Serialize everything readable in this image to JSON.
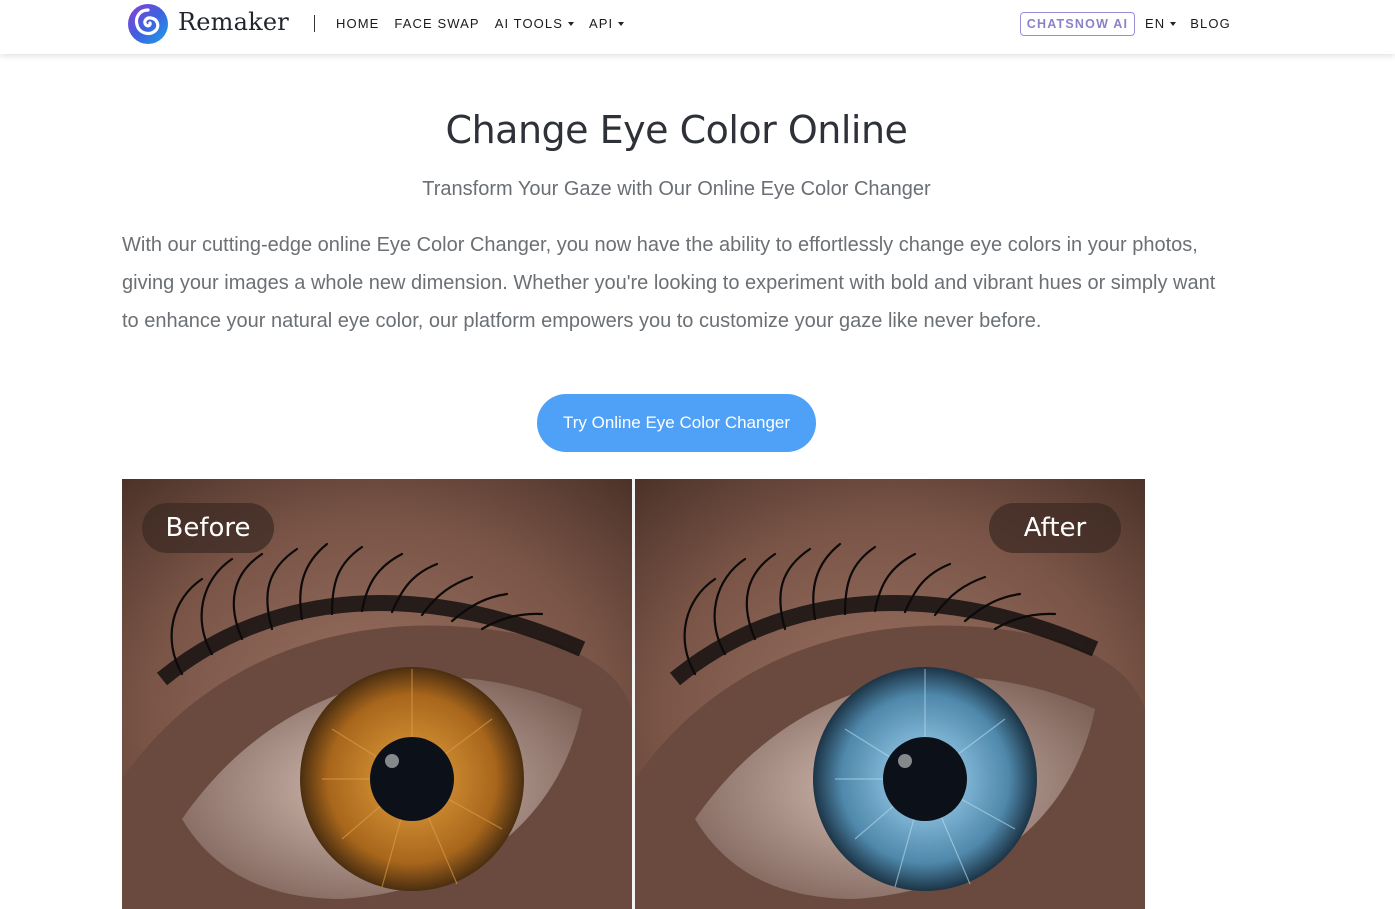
{
  "header": {
    "brand": "Remaker",
    "nav_left": [
      {
        "label": "HOME",
        "dropdown": false
      },
      {
        "label": "FACE SWAP",
        "dropdown": false
      },
      {
        "label": "AI TOOLS",
        "dropdown": true
      },
      {
        "label": "API",
        "dropdown": true
      }
    ],
    "chatsnow_label": "CHATSNOW AI",
    "language_label": "EN",
    "blog_label": "BLOG"
  },
  "main": {
    "title": "Change Eye Color Online",
    "subtitle": "Transform Your Gaze with Our Online Eye Color Changer",
    "description": "With our cutting-edge online Eye Color Changer, you now have the ability to effortlessly change eye colors in your photos, giving your images a whole new dimension. Whether you're looking to experiment with bold and vibrant hues or simply want to enhance your natural eye color, our platform empowers you to customize your gaze like never before.",
    "cta_label": "Try Online Eye Color Changer"
  },
  "comparison": {
    "before_label": "Before",
    "after_label": "After",
    "before_iris_color": "#b8772a",
    "after_iris_color": "#5b95b8"
  },
  "colors": {
    "accent": "#4fa0f7",
    "chatsnow_border": "#9b8fd6",
    "body_text": "#6b7075",
    "title_text": "#2e3238"
  }
}
